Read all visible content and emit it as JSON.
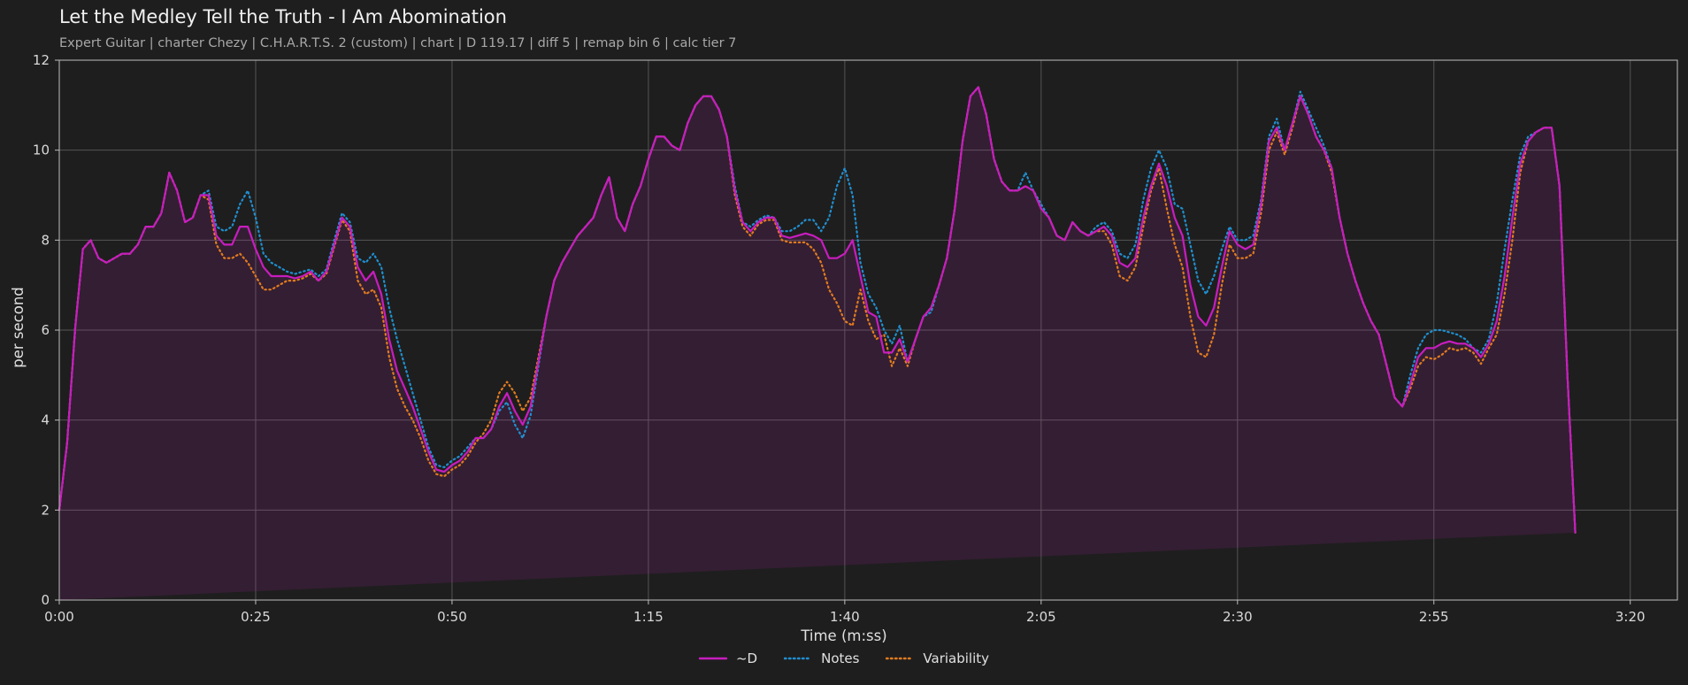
{
  "chart_data": {
    "type": "line",
    "title": "Let the Medley Tell the Truth - I Am Abomination",
    "subtitle": "Expert Guitar  |  charter Chezy  |  C.H.A.R.T.S. 2 (custom)  |  chart  |  D 119.17  |  diff 5  |  remap bin 6  |  calc tier 7",
    "xlabel": "Time (m:ss)",
    "ylabel": "per second",
    "xlim": [
      0,
      206
    ],
    "ylim": [
      0,
      12
    ],
    "x_ticks": [
      0,
      25,
      50,
      75,
      100,
      125,
      150,
      175,
      200
    ],
    "x_tick_labels": [
      "0:00",
      "0:25",
      "0:50",
      "1:15",
      "1:40",
      "2:05",
      "2:30",
      "2:55",
      "3:20"
    ],
    "y_ticks": [
      0,
      2,
      4,
      6,
      8,
      10,
      12
    ],
    "y_tick_labels": [
      "0",
      "2",
      "4",
      "6",
      "8",
      "10",
      "12"
    ],
    "grid": true,
    "legend_position": "bottom-center",
    "x": [
      0,
      1,
      2,
      3,
      4,
      5,
      6,
      7,
      8,
      9,
      10,
      11,
      12,
      13,
      14,
      15,
      16,
      17,
      18,
      19,
      20,
      21,
      22,
      23,
      24,
      25,
      26,
      27,
      28,
      29,
      30,
      31,
      32,
      33,
      34,
      35,
      36,
      37,
      38,
      39,
      40,
      41,
      42,
      43,
      44,
      45,
      46,
      47,
      48,
      49,
      50,
      51,
      52,
      53,
      54,
      55,
      56,
      57,
      58,
      59,
      60,
      61,
      62,
      63,
      64,
      65,
      66,
      67,
      68,
      69,
      70,
      71,
      72,
      73,
      74,
      75,
      76,
      77,
      78,
      79,
      80,
      81,
      82,
      83,
      84,
      85,
      86,
      87,
      88,
      89,
      90,
      91,
      92,
      93,
      94,
      95,
      96,
      97,
      98,
      99,
      100,
      101,
      102,
      103,
      104,
      105,
      106,
      107,
      108,
      109,
      110,
      111,
      112,
      113,
      114,
      115,
      116,
      117,
      118,
      119,
      120,
      121,
      122,
      123,
      124,
      125,
      126,
      127,
      128,
      129,
      130,
      131,
      132,
      133,
      134,
      135,
      136,
      137,
      138,
      139,
      140,
      141,
      142,
      143,
      144,
      145,
      146,
      147,
      148,
      149,
      150,
      151,
      152,
      153,
      154,
      155,
      156,
      157,
      158,
      159,
      160,
      161,
      162,
      163,
      164,
      165,
      166,
      167,
      168,
      169,
      170,
      171,
      172,
      173,
      174,
      175,
      176,
      177,
      178,
      179,
      180,
      181,
      182,
      183,
      184,
      185,
      186,
      187,
      188,
      189,
      190,
      191,
      192,
      193,
      194,
      195,
      196,
      197,
      198,
      199,
      200,
      201,
      202,
      203,
      204,
      205,
      206
    ],
    "series": [
      {
        "name": "~D",
        "color": "#c81dbf",
        "style": "solid",
        "values": [
          2.0,
          3.5,
          6.0,
          7.8,
          8.0,
          7.6,
          7.5,
          7.6,
          7.7,
          7.7,
          7.9,
          8.3,
          8.3,
          8.6,
          9.5,
          9.1,
          8.4,
          8.5,
          9.0,
          9.0,
          8.1,
          7.9,
          7.9,
          8.3,
          8.3,
          7.8,
          7.4,
          7.2,
          7.2,
          7.2,
          7.15,
          7.2,
          7.3,
          7.1,
          7.3,
          7.9,
          8.5,
          8.3,
          7.4,
          7.1,
          7.3,
          6.8,
          5.8,
          5.1,
          4.7,
          4.3,
          3.8,
          3.3,
          2.9,
          2.85,
          3.0,
          3.1,
          3.3,
          3.6,
          3.6,
          3.8,
          4.3,
          4.6,
          4.2,
          3.9,
          4.3,
          5.3,
          6.3,
          7.1,
          7.5,
          7.8,
          8.1,
          8.3,
          8.5,
          9.0,
          9.4,
          8.5,
          8.2,
          8.8,
          9.2,
          9.8,
          10.3,
          10.3,
          10.1,
          10.0,
          10.6,
          11.0,
          11.2,
          11.2,
          10.9,
          10.3,
          9.1,
          8.4,
          8.2,
          8.4,
          8.5,
          8.5,
          8.1,
          8.05,
          8.1,
          8.15,
          8.1,
          8.0,
          7.6,
          7.6,
          7.7,
          8.0,
          7.2,
          6.4,
          6.3,
          5.5,
          5.5,
          5.8,
          5.3,
          5.8,
          6.3,
          6.5,
          7.0,
          7.6,
          8.7,
          10.2,
          11.2,
          11.4,
          10.8,
          9.8,
          9.3,
          9.1,
          9.1,
          9.2,
          9.1,
          8.7,
          8.5,
          8.1,
          8.0,
          8.4,
          8.2,
          8.1,
          8.2,
          8.3,
          8.1,
          7.5,
          7.4,
          7.6,
          8.5,
          9.2,
          9.7,
          9.2,
          8.5,
          8.1,
          7.0,
          6.3,
          6.1,
          6.5,
          7.4,
          8.2,
          7.9,
          7.8,
          7.9,
          8.8,
          10.2,
          10.5,
          10.0,
          10.6,
          11.2,
          10.8,
          10.3,
          10.0,
          9.6,
          8.5,
          7.7,
          7.1,
          6.6,
          6.2,
          5.9,
          5.2,
          4.5,
          4.3,
          4.8,
          5.4,
          5.6,
          5.6,
          5.7,
          5.75,
          5.7,
          5.7,
          5.6,
          5.4,
          5.7,
          6.2,
          7.2,
          8.5,
          9.7,
          10.2,
          10.4,
          10.5,
          10.5,
          9.2,
          5.0,
          1.5
        ]
      },
      {
        "name": "Notes",
        "color": "#1f8fcf",
        "style": "dotted",
        "values": [
          2.0,
          3.5,
          6.0,
          7.8,
          8.0,
          7.6,
          7.5,
          7.6,
          7.7,
          7.7,
          7.9,
          8.3,
          8.3,
          8.6,
          9.5,
          9.1,
          8.4,
          8.5,
          9.0,
          9.1,
          8.3,
          8.2,
          8.3,
          8.8,
          9.1,
          8.5,
          7.7,
          7.5,
          7.4,
          7.3,
          7.25,
          7.3,
          7.35,
          7.2,
          7.35,
          8.0,
          8.6,
          8.4,
          7.6,
          7.5,
          7.7,
          7.4,
          6.5,
          5.8,
          5.2,
          4.6,
          4.0,
          3.4,
          3.0,
          2.95,
          3.1,
          3.2,
          3.4,
          3.6,
          3.6,
          3.8,
          4.2,
          4.4,
          3.9,
          3.6,
          4.1,
          5.2,
          6.3,
          7.1,
          7.5,
          7.8,
          8.1,
          8.3,
          8.5,
          9.0,
          9.4,
          8.5,
          8.2,
          8.8,
          9.2,
          9.8,
          10.3,
          10.3,
          10.1,
          10.0,
          10.6,
          11.0,
          11.2,
          11.2,
          10.9,
          10.3,
          9.2,
          8.4,
          8.3,
          8.45,
          8.55,
          8.5,
          8.2,
          8.2,
          8.3,
          8.45,
          8.45,
          8.2,
          8.5,
          9.2,
          9.6,
          9.0,
          7.5,
          6.8,
          6.5,
          6.0,
          5.7,
          6.1,
          5.3,
          5.8,
          6.3,
          6.4,
          7.0,
          7.6,
          8.7,
          10.2,
          11.2,
          11.4,
          10.8,
          9.8,
          9.3,
          9.1,
          9.1,
          9.5,
          9.1,
          8.8,
          8.5,
          8.1,
          8.0,
          8.4,
          8.2,
          8.1,
          8.3,
          8.4,
          8.2,
          7.7,
          7.6,
          7.9,
          8.9,
          9.6,
          10.0,
          9.6,
          8.8,
          8.7,
          7.9,
          7.1,
          6.8,
          7.2,
          7.8,
          8.3,
          8.0,
          8.0,
          8.1,
          8.9,
          10.3,
          10.7,
          10.0,
          10.6,
          11.3,
          10.9,
          10.5,
          10.1,
          9.6,
          8.5,
          7.7,
          7.1,
          6.6,
          6.2,
          5.9,
          5.2,
          4.5,
          4.3,
          5.0,
          5.6,
          5.9,
          6.0,
          6.0,
          5.95,
          5.9,
          5.8,
          5.6,
          5.5,
          5.8,
          6.6,
          7.8,
          8.9,
          9.9,
          10.3,
          10.4,
          10.5,
          10.5,
          9.2,
          5.0,
          1.5
        ]
      },
      {
        "name": "Variability",
        "color": "#e07b1f",
        "style": "dotted",
        "values": [
          2.0,
          3.5,
          6.0,
          7.8,
          8.0,
          7.6,
          7.5,
          7.6,
          7.7,
          7.7,
          7.9,
          8.3,
          8.3,
          8.6,
          9.5,
          9.1,
          8.4,
          8.5,
          9.0,
          8.9,
          7.9,
          7.6,
          7.6,
          7.7,
          7.5,
          7.2,
          6.9,
          6.9,
          7.0,
          7.1,
          7.1,
          7.15,
          7.25,
          7.1,
          7.25,
          7.85,
          8.45,
          8.2,
          7.1,
          6.8,
          6.9,
          6.5,
          5.4,
          4.7,
          4.3,
          4.0,
          3.6,
          3.1,
          2.8,
          2.75,
          2.9,
          3.0,
          3.2,
          3.5,
          3.7,
          4.0,
          4.6,
          4.85,
          4.6,
          4.2,
          4.5,
          5.4,
          6.3,
          7.1,
          7.5,
          7.8,
          8.1,
          8.3,
          8.5,
          9.0,
          9.4,
          8.5,
          8.2,
          8.8,
          9.2,
          9.8,
          10.3,
          10.3,
          10.1,
          10.0,
          10.6,
          11.0,
          11.2,
          11.2,
          10.9,
          10.3,
          9.0,
          8.3,
          8.1,
          8.35,
          8.45,
          8.45,
          8.0,
          7.95,
          7.95,
          7.95,
          7.8,
          7.5,
          6.9,
          6.6,
          6.2,
          6.1,
          6.9,
          6.2,
          5.8,
          5.9,
          5.2,
          5.6,
          5.2,
          5.8,
          6.3,
          6.5,
          7.0,
          7.6,
          8.7,
          10.2,
          11.2,
          11.4,
          10.8,
          9.8,
          9.3,
          9.1,
          9.1,
          9.2,
          9.1,
          8.7,
          8.5,
          8.1,
          8.0,
          8.4,
          8.2,
          8.1,
          8.2,
          8.2,
          7.9,
          7.2,
          7.1,
          7.4,
          8.3,
          9.1,
          9.6,
          8.7,
          7.9,
          7.4,
          6.3,
          5.5,
          5.4,
          5.9,
          7.0,
          7.9,
          7.6,
          7.6,
          7.7,
          8.6,
          10.0,
          10.4,
          9.9,
          10.5,
          11.2,
          10.8,
          10.3,
          10.0,
          9.5,
          8.5,
          7.7,
          7.1,
          6.6,
          6.2,
          5.9,
          5.2,
          4.5,
          4.3,
          4.7,
          5.2,
          5.4,
          5.35,
          5.45,
          5.6,
          5.55,
          5.6,
          5.5,
          5.25,
          5.6,
          5.9,
          6.8,
          8.0,
          9.5,
          10.2,
          10.4,
          10.5,
          10.5,
          9.2,
          5.0,
          1.5
        ]
      }
    ]
  }
}
